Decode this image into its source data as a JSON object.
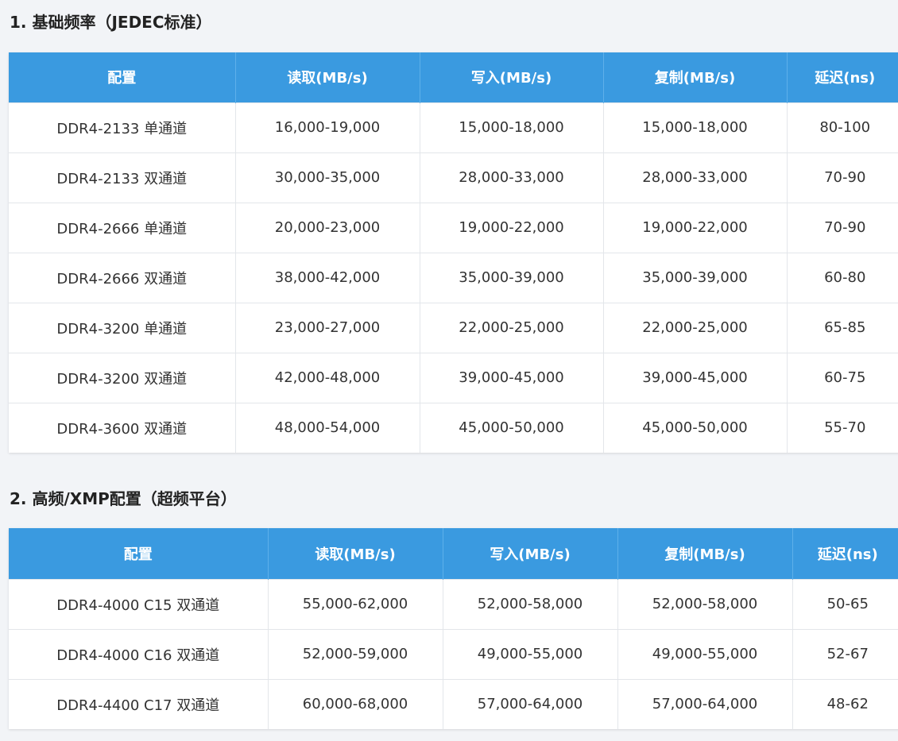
{
  "sections": [
    {
      "title": "1. 基础频率（JEDEC标准）",
      "headers": [
        "配置",
        "读取(MB/s)",
        "写入(MB/s)",
        "复制(MB/s)",
        "延迟(ns)"
      ],
      "rows": [
        [
          "DDR4-2133 单通道",
          "16,000-19,000",
          "15,000-18,000",
          "15,000-18,000",
          "80-100"
        ],
        [
          "DDR4-2133 双通道",
          "30,000-35,000",
          "28,000-33,000",
          "28,000-33,000",
          "70-90"
        ],
        [
          "DDR4-2666 单通道",
          "20,000-23,000",
          "19,000-22,000",
          "19,000-22,000",
          "70-90"
        ],
        [
          "DDR4-2666 双通道",
          "38,000-42,000",
          "35,000-39,000",
          "35,000-39,000",
          "60-80"
        ],
        [
          "DDR4-3200 单通道",
          "23,000-27,000",
          "22,000-25,000",
          "22,000-25,000",
          "65-85"
        ],
        [
          "DDR4-3200 双通道",
          "42,000-48,000",
          "39,000-45,000",
          "39,000-45,000",
          "60-75"
        ],
        [
          "DDR4-3600 双通道",
          "48,000-54,000",
          "45,000-50,000",
          "45,000-50,000",
          "55-70"
        ]
      ]
    },
    {
      "title": "2. 高频/XMP配置（超频平台）",
      "headers": [
        "配置",
        "读取(MB/s)",
        "写入(MB/s)",
        "复制(MB/s)",
        "延迟(ns)"
      ],
      "rows": [
        [
          "DDR4-4000 C15 双通道",
          "55,000-62,000",
          "52,000-58,000",
          "52,000-58,000",
          "50-65"
        ],
        [
          "DDR4-4000 C16 双通道",
          "52,000-59,000",
          "49,000-55,000",
          "49,000-55,000",
          "52-67"
        ],
        [
          "DDR4-4400 C17 双通道",
          "60,000-68,000",
          "57,000-64,000",
          "57,000-64,000",
          "48-62"
        ]
      ]
    }
  ],
  "colors": {
    "header_bg": "#3a9ae0",
    "header_text": "#ffffff",
    "page_bg": "#f2f4f7"
  }
}
